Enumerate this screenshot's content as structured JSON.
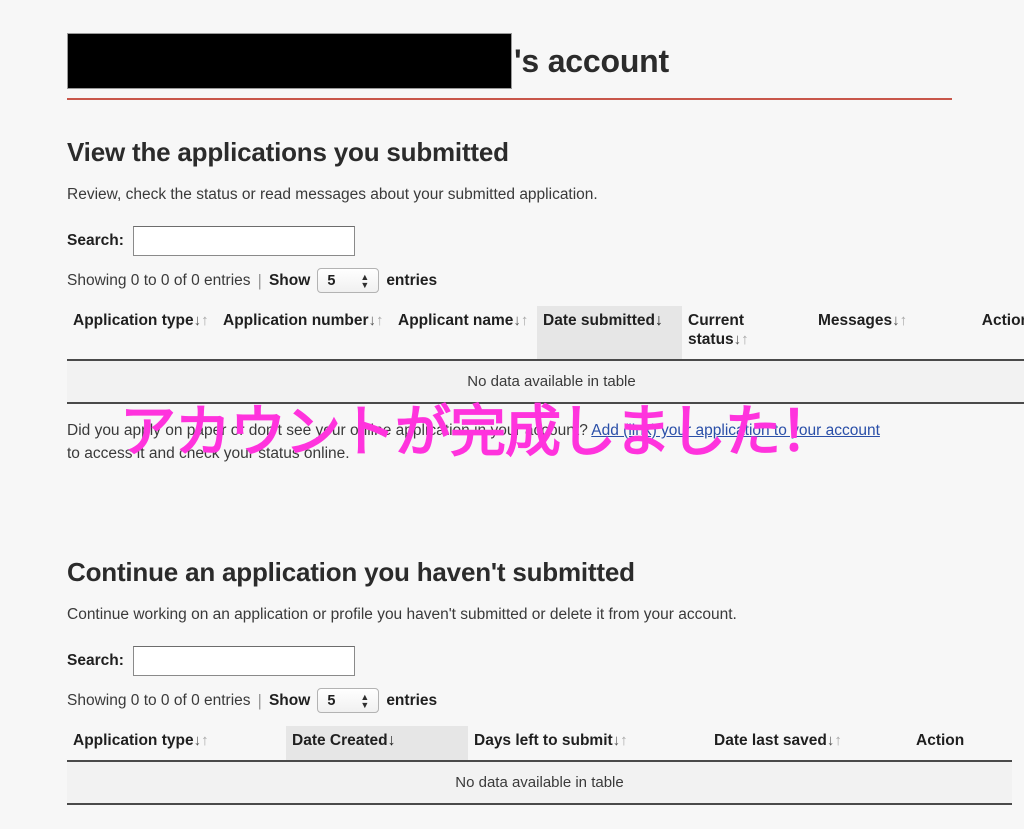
{
  "header": {
    "redacted_name": "",
    "title_suffix": "'s account",
    "accent_color": "#c0392b"
  },
  "overlay": {
    "text": "アカウントが完成しました！",
    "color": "#ff33dd"
  },
  "sections": {
    "submitted": {
      "heading": "View the applications you submitted",
      "description": "Review, check the status or read messages about your submitted application.",
      "search_label": "Search:",
      "search_value": "",
      "search_placeholder": "",
      "showing_text": "Showing 0 to 0 of 0 entries",
      "separator": "|",
      "show_label": "Show",
      "entries_value": "5",
      "entries_label": "entries",
      "columns": [
        {
          "label": "Application type",
          "sort": "both"
        },
        {
          "label": "Application number",
          "sort": "both"
        },
        {
          "label": "Applicant name",
          "sort": "both"
        },
        {
          "label": "Date submitted",
          "sort": "desc"
        },
        {
          "label": "Current status",
          "sort": "both"
        },
        {
          "label": "Messages",
          "sort": "both"
        },
        {
          "label": "Action",
          "sort": "none"
        }
      ],
      "empty_message": "No data available in table",
      "helper": {
        "lead": "Did you apply on paper or don't see your online application in your account? ",
        "link": "Add (link) your application to your account",
        "tail": " to access it and check your status online."
      }
    },
    "continue": {
      "heading": "Continue an application you haven't submitted",
      "description": "Continue working on an application or profile you haven't submitted or delete it from your account.",
      "search_label": "Search:",
      "search_value": "",
      "search_placeholder": "",
      "showing_text": "Showing 0 to 0 of 0 entries",
      "separator": "|",
      "show_label": "Show",
      "entries_value": "5",
      "entries_label": "entries",
      "columns": [
        {
          "label": "Application type",
          "sort": "both"
        },
        {
          "label": "Date Created",
          "sort": "desc"
        },
        {
          "label": "Days left to submit",
          "sort": "both"
        },
        {
          "label": "Date last saved",
          "sort": "both"
        },
        {
          "label": "Action",
          "sort": "none"
        }
      ],
      "empty_message": "No data available in table"
    }
  },
  "icons": {
    "sort_down": "↓",
    "sort_up": "↑",
    "sort_active_down": "↓",
    "stepper_up": "▲",
    "stepper_down": "▼"
  }
}
